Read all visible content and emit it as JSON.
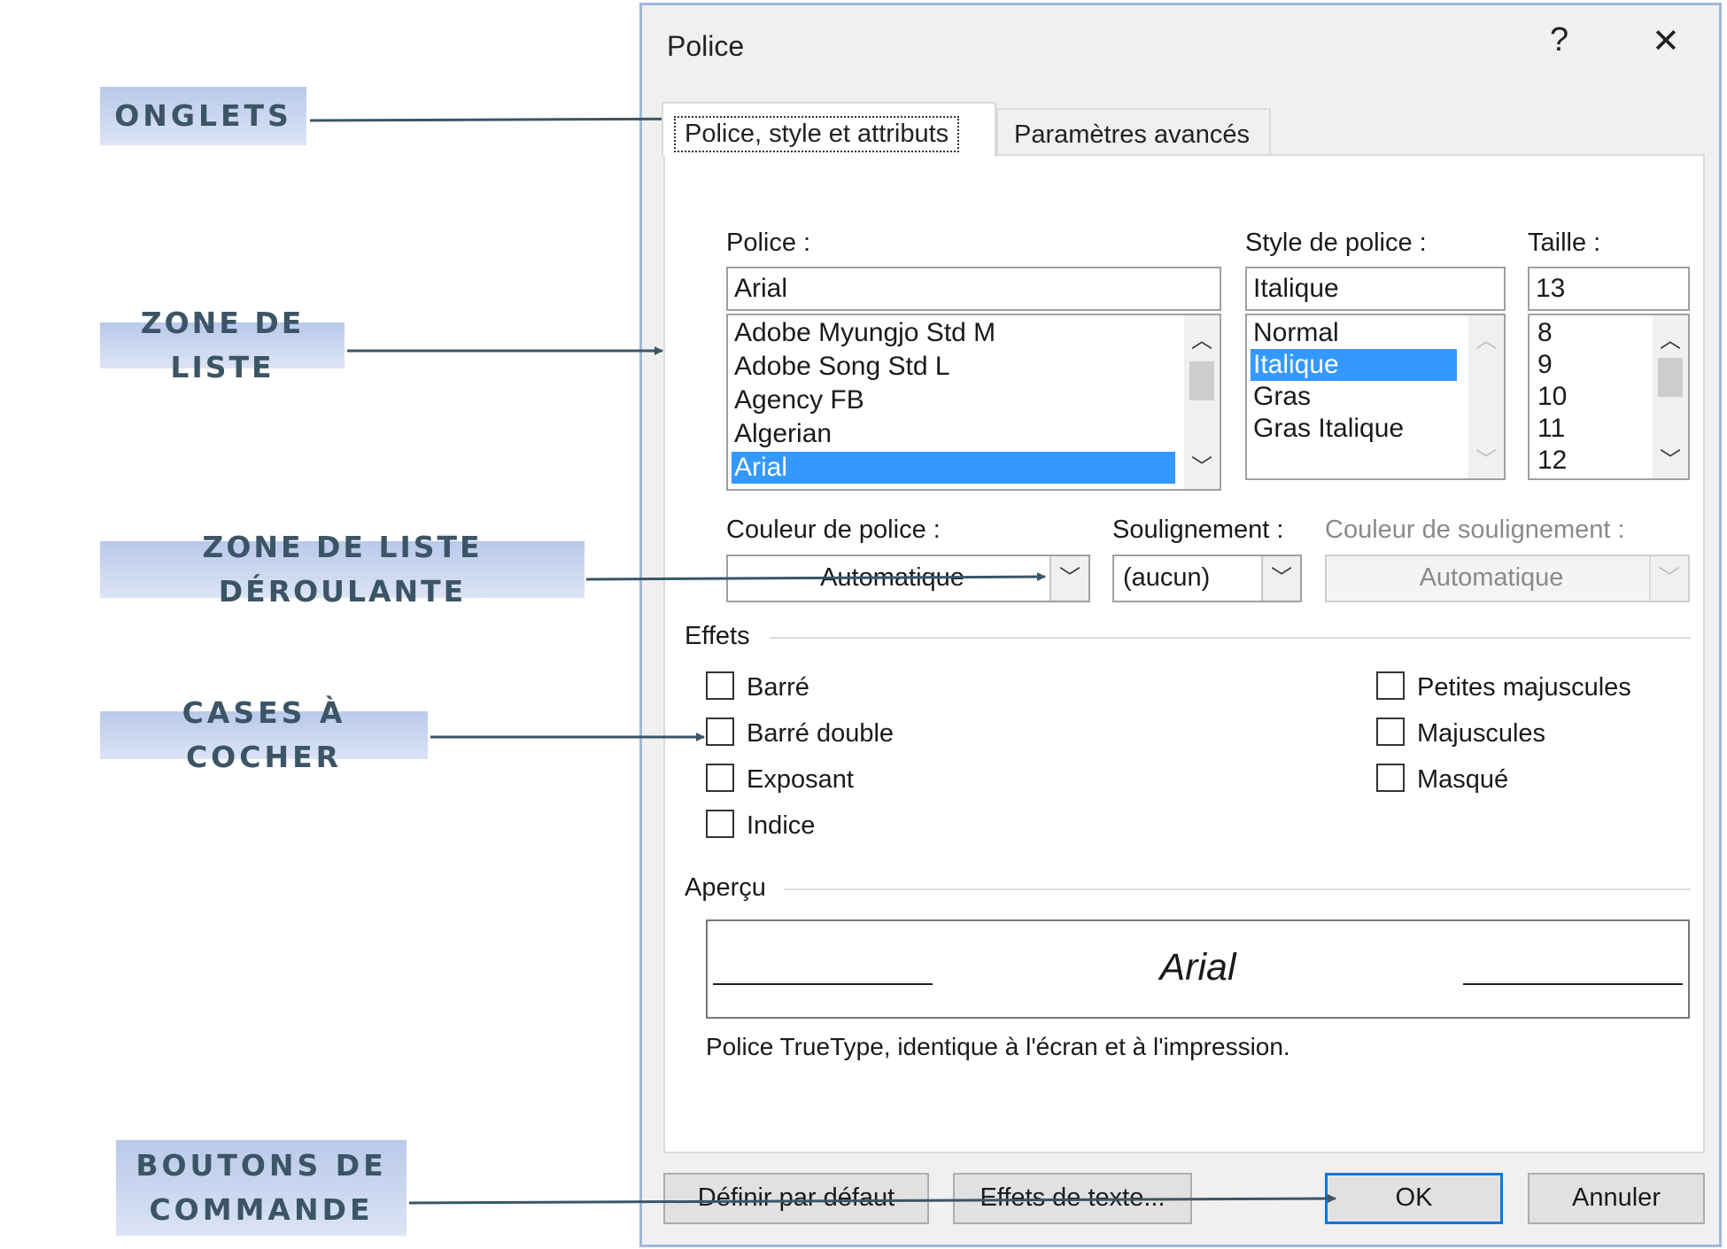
{
  "callouts": {
    "onglets": "ONGLETS",
    "zone_liste": "ZONE DE LISTE",
    "zone_liste_deroulante": "ZONE DE LISTE DÉROULANTE",
    "cases_cocher": "CASES À COCHER",
    "boutons_line1": "BOUTONS DE",
    "boutons_line2": "COMMANDE"
  },
  "dialog": {
    "title": "Police",
    "help": "?",
    "close": "✕",
    "tabs": [
      "Police, style et attributs",
      "Paramètres avancés"
    ],
    "font_label": "Police :",
    "font_value": "Arial",
    "font_list": [
      "Adobe Myungjo Std M",
      "Adobe Song Std L",
      "Agency FB",
      "Algerian",
      "Arial"
    ],
    "style_label": "Style de police :",
    "style_value": "Italique",
    "style_list": [
      "Normal",
      "Italique",
      "Gras",
      "Gras Italique"
    ],
    "size_label": "Taille :",
    "size_value": "13",
    "size_list": [
      "8",
      "9",
      "10",
      "11",
      "12"
    ],
    "color_label": "Couleur de police :",
    "color_value": "Automatique",
    "underline_label": "Soulignement :",
    "underline_value": "(aucun)",
    "underline_color_label": "Couleur de soulignement :",
    "underline_color_value": "Automatique",
    "effects_label": "Effets",
    "effects_left": [
      "Barré",
      "Barré double",
      "Exposant",
      "Indice"
    ],
    "effects_right": [
      "Petites majuscules",
      "Majuscules",
      "Masqué"
    ],
    "preview_label": "Aperçu",
    "preview_text": "Arial",
    "preview_note": "Police TrueType, identique à l'écran et à l'impression.",
    "btn_default": "Définir par défaut",
    "btn_effects": "Effets de texte...",
    "btn_ok": "OK",
    "btn_cancel": "Annuler"
  },
  "colors": {
    "selection": "#3399ff",
    "callout_text": "#3c5566",
    "arrow": "#3c5566",
    "ok_border": "#0078d7"
  }
}
